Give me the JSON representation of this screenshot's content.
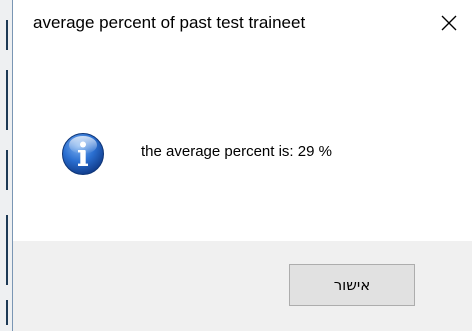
{
  "dialog": {
    "title": "average percent of past test traineet",
    "message": "the average percent is: 29 %",
    "ok_label": "אישור"
  },
  "icons": {
    "close": "close-icon",
    "info": "info-icon"
  },
  "colors": {
    "footer_bg": "#f0f0f0",
    "button_bg": "#e1e1e1",
    "button_border": "#adadad",
    "info_icon_blue": "#1f5fbf"
  }
}
